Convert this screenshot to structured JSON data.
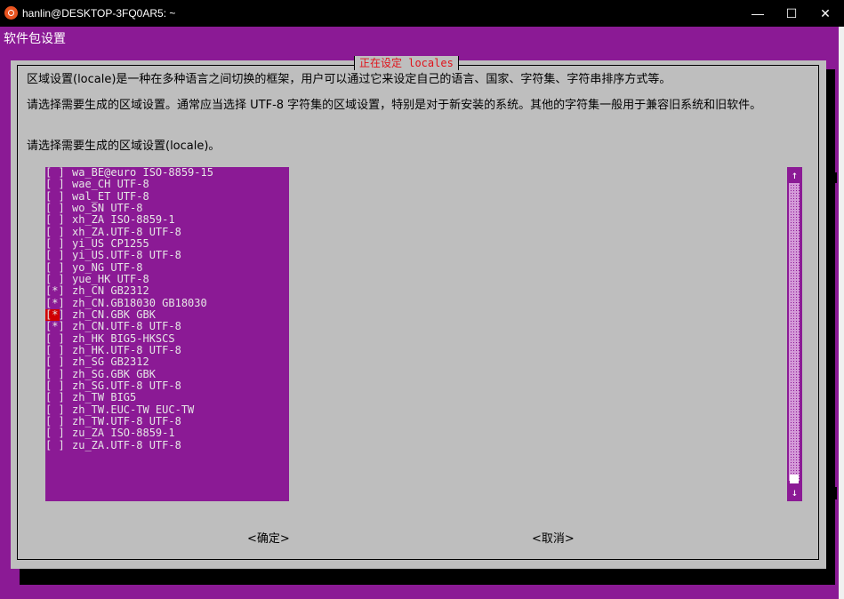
{
  "window": {
    "title": "hanlin@DESKTOP-3FQ0AR5: ~",
    "minimize_label": "—",
    "maximize_label": "☐",
    "close_label": "✕"
  },
  "terminal": {
    "heading": "软件包设置"
  },
  "dialog": {
    "title": "正在设定 locales",
    "paragraph1": "区域设置(locale)是一种在多种语言之间切换的框架，用户可以通过它来设定自己的语言、国家、字符集、字符串排序方式等。",
    "paragraph2": "请选择需要生成的区域设置。通常应当选择 UTF-8 字符集的区域设置，特别是对于新安装的系统。其他的字符集一般用于兼容旧系统和旧软件。",
    "paragraph3": "请选择需要生成的区域设置(locale)。",
    "ok_label": "<确定>",
    "cancel_label": "<取消>",
    "items": [
      {
        "box": "[ ]",
        "label": "wa_BE@euro ISO-8859-15"
      },
      {
        "box": "[ ]",
        "label": "wae_CH UTF-8"
      },
      {
        "box": "[ ]",
        "label": "wal_ET UTF-8"
      },
      {
        "box": "[ ]",
        "label": "wo_SN UTF-8"
      },
      {
        "box": "[ ]",
        "label": "xh_ZA ISO-8859-1"
      },
      {
        "box": "[ ]",
        "label": "xh_ZA.UTF-8 UTF-8"
      },
      {
        "box": "[ ]",
        "label": "yi_US CP1255"
      },
      {
        "box": "[ ]",
        "label": "yi_US.UTF-8 UTF-8"
      },
      {
        "box": "[ ]",
        "label": "yo_NG UTF-8"
      },
      {
        "box": "[ ]",
        "label": "yue_HK UTF-8"
      },
      {
        "box": "[*]",
        "label": "zh_CN GB2312"
      },
      {
        "box": "[*]",
        "label": "zh_CN.GB18030 GB18030"
      },
      {
        "box": "[*]",
        "label": "zh_CN.GBK GBK",
        "cursor": true
      },
      {
        "box": "[*]",
        "label": "zh_CN.UTF-8 UTF-8"
      },
      {
        "box": "[ ]",
        "label": "zh_HK BIG5-HKSCS"
      },
      {
        "box": "[ ]",
        "label": "zh_HK.UTF-8 UTF-8"
      },
      {
        "box": "[ ]",
        "label": "zh_SG GB2312"
      },
      {
        "box": "[ ]",
        "label": "zh_SG.GBK GBK"
      },
      {
        "box": "[ ]",
        "label": "zh_SG.UTF-8 UTF-8"
      },
      {
        "box": "[ ]",
        "label": "zh_TW BIG5"
      },
      {
        "box": "[ ]",
        "label": "zh_TW.EUC-TW EUC-TW"
      },
      {
        "box": "[ ]",
        "label": "zh_TW.UTF-8 UTF-8"
      },
      {
        "box": "[ ]",
        "label": "zu_ZA ISO-8859-1"
      },
      {
        "box": "[ ]",
        "label": "zu_ZA.UTF-8 UTF-8"
      }
    ]
  },
  "scrollbar": {
    "up_arrow": "↑",
    "down_arrow": "↓"
  }
}
